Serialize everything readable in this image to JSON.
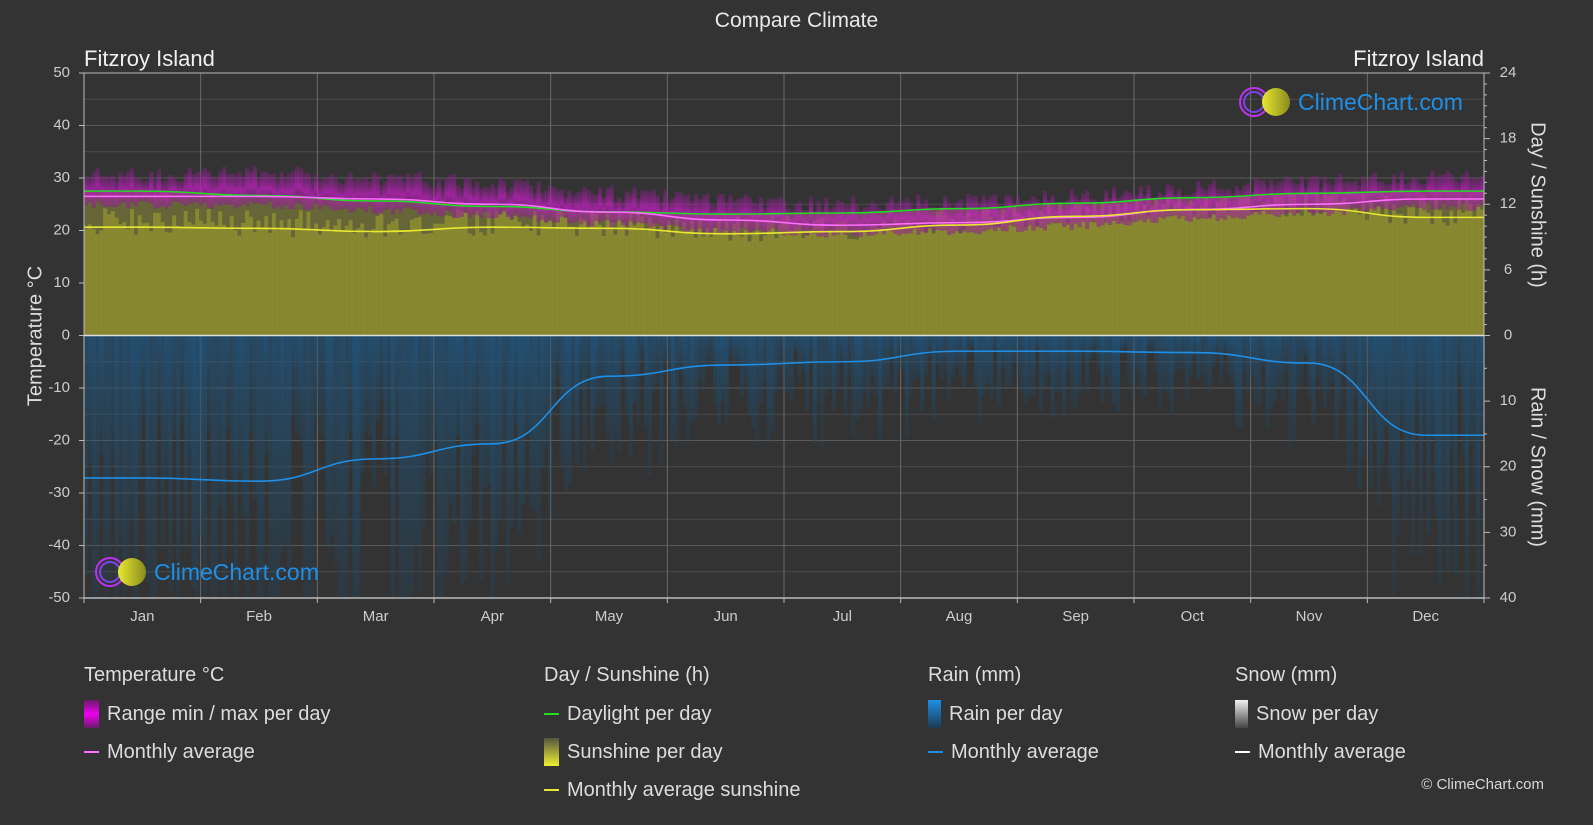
{
  "title": "Compare Climate",
  "location_left": "Fitzroy Island",
  "location_right": "Fitzroy Island",
  "watermark": "ClimeChart.com",
  "copyright": "© ClimeChart.com",
  "colors": {
    "background": "#333333",
    "grid": "#5a5a5a",
    "temp_range": "#c21fc2",
    "temp_avg": "#ff6eff",
    "daylight": "#22dd22",
    "sunshine_fill": "#8a8a30",
    "sunshine_avg": "#e8e830",
    "rain_fill": "#1c5a8a",
    "rain_avg": "#1e8fe6",
    "snow_avg": "#ffffff",
    "logo_text": "#1e8fe6"
  },
  "legend": {
    "temperature": {
      "title": "Temperature °C",
      "items": [
        {
          "label": "Range min / max per day",
          "icon": "temp-range-swatch"
        },
        {
          "label": "Monthly average",
          "icon": "temp-avg-line"
        }
      ]
    },
    "sunshine": {
      "title": "Day / Sunshine (h)",
      "items": [
        {
          "label": "Daylight per day",
          "icon": "daylight-line"
        },
        {
          "label": "Sunshine per day",
          "icon": "sunshine-swatch"
        },
        {
          "label": "Monthly average sunshine",
          "icon": "sunshine-avg-line"
        }
      ]
    },
    "rain": {
      "title": "Rain (mm)",
      "items": [
        {
          "label": "Rain per day",
          "icon": "rain-swatch"
        },
        {
          "label": "Monthly average",
          "icon": "rain-avg-line"
        }
      ]
    },
    "snow": {
      "title": "Snow (mm)",
      "items": [
        {
          "label": "Snow per day",
          "icon": "snow-swatch"
        },
        {
          "label": "Monthly average",
          "icon": "snow-avg-line"
        }
      ]
    }
  },
  "chart_data": {
    "type": "area",
    "title": "Compare Climate",
    "categories": [
      "Jan",
      "Feb",
      "Mar",
      "Apr",
      "May",
      "Jun",
      "Jul",
      "Aug",
      "Sep",
      "Oct",
      "Nov",
      "Dec"
    ],
    "y_left": {
      "label": "Temperature °C",
      "range": [
        -50,
        50
      ],
      "ticks": [
        50,
        40,
        30,
        20,
        10,
        0,
        -10,
        -20,
        -30,
        -40,
        -50
      ]
    },
    "y_right_top": {
      "label": "Day / Sunshine (h)",
      "range": [
        0,
        24
      ],
      "ticks": [
        24,
        18,
        12,
        6,
        0
      ]
    },
    "y_right_bottom": {
      "label": "Rain / Snow (mm)",
      "range": [
        0,
        40
      ],
      "ticks": [
        0,
        10,
        20,
        30,
        40
      ]
    },
    "grid": true,
    "legend_position": "bottom",
    "series": [
      {
        "name": "Temperature monthly average (°C)",
        "axis": "left",
        "values": [
          26.5,
          26.5,
          26.0,
          25.0,
          23.5,
          22.0,
          21.0,
          21.5,
          22.5,
          24.0,
          25.0,
          26.0
        ]
      },
      {
        "name": "Temperature max per day (approx °C)",
        "axis": "left",
        "values": [
          30,
          30.5,
          29.5,
          28.5,
          26.5,
          25,
          24.5,
          25,
          26,
          27.5,
          28.5,
          29.5
        ]
      },
      {
        "name": "Temperature min per day (approx °C)",
        "axis": "left",
        "values": [
          25,
          25,
          24,
          23,
          21.5,
          20,
          19.5,
          20,
          21,
          22.5,
          23.5,
          24.5
        ]
      },
      {
        "name": "Daylight per day (h)",
        "axis": "right_top",
        "values": [
          13.2,
          12.8,
          12.3,
          11.8,
          11.3,
          11.1,
          11.2,
          11.6,
          12.1,
          12.6,
          13.0,
          13.2
        ]
      },
      {
        "name": "Monthly average sunshine (h)",
        "axis": "right_top",
        "values": [
          9.9,
          9.8,
          9.5,
          9.9,
          9.8,
          9.3,
          9.5,
          10.1,
          10.9,
          11.5,
          11.6,
          10.8
        ]
      },
      {
        "name": "Rain monthly average (mm)",
        "axis": "right_bottom",
        "values": [
          21.7,
          22.2,
          18.8,
          16.5,
          6.2,
          4.5,
          4.0,
          2.4,
          2.4,
          2.6,
          4.2,
          15.2
        ]
      },
      {
        "name": "Snow monthly average (mm)",
        "axis": "right_bottom",
        "values": [
          0,
          0,
          0,
          0,
          0,
          0,
          0,
          0,
          0,
          0,
          0,
          0
        ]
      }
    ]
  }
}
